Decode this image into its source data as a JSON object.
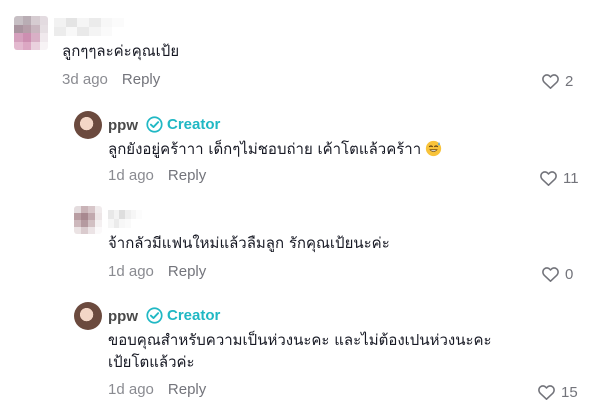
{
  "comments": [
    {
      "text": "ลูกๆๆละค่ะคุณเป้ย",
      "time": "3d ago",
      "reply_label": "Reply",
      "likes": "2"
    },
    {
      "username": "ppw",
      "badge": "Creator",
      "text": "ลูกยังอยู่คร้าาา เด็กๆไม่ชอบถ่าย เค้าโตแล้วคร้าา",
      "emoji": "smiling-face-with-sweat-icon",
      "time": "1d ago",
      "reply_label": "Reply",
      "likes": "11"
    },
    {
      "text": "จ้ากลัวมีแฟนใหม่แล้วลืมลูก รักคุณเป้ยนะค่ะ",
      "time": "1d ago",
      "reply_label": "Reply",
      "likes": "0"
    },
    {
      "username": "ppw",
      "badge": "Creator",
      "text_line1": "ขอบคุณสำหรับความเป็นห่วงนะคะ และไม่ต้องเปนห่วงนะคะ",
      "text_line2": "เป้ยโตแล้วค่ะ",
      "time": "1d ago",
      "reply_label": "Reply",
      "likes": "15"
    }
  ],
  "colors": {
    "creator": "#20b8c4",
    "meta": "#8a8b91",
    "text": "#161823"
  }
}
